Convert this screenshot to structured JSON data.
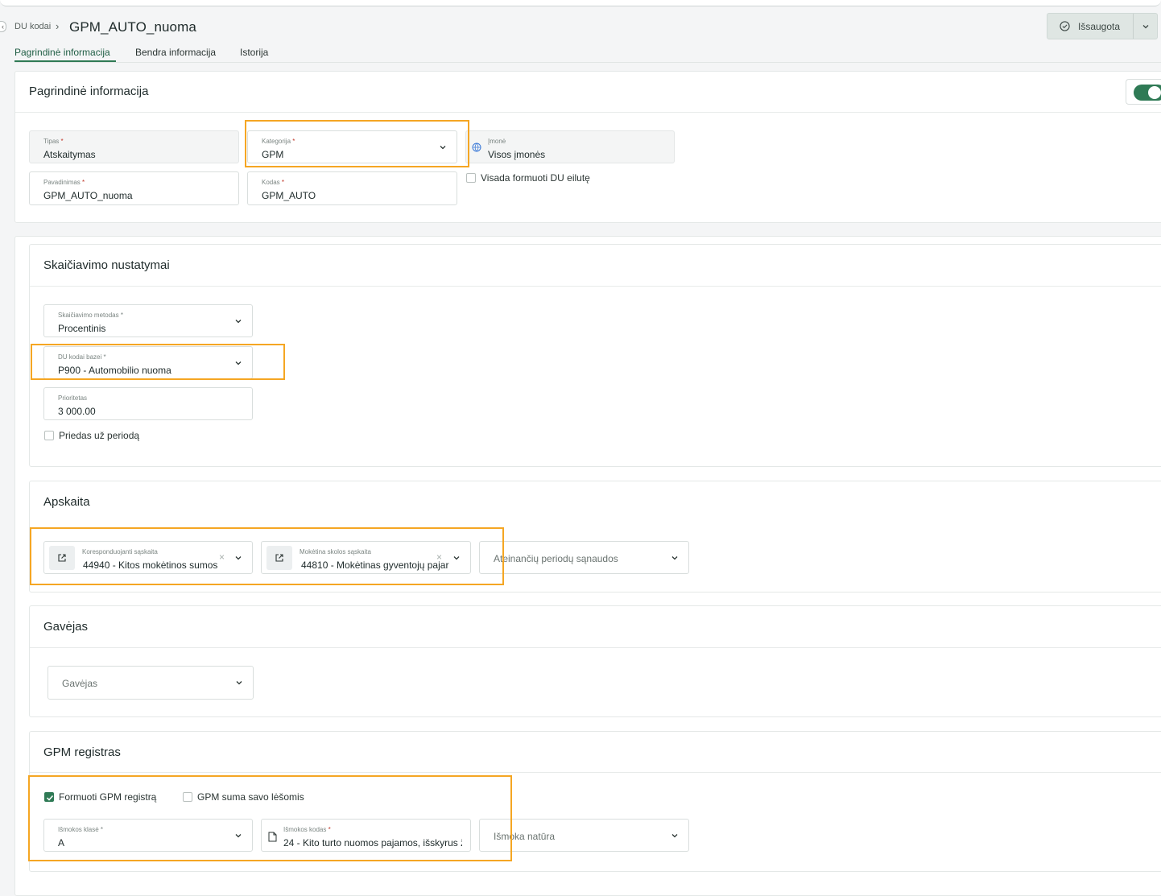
{
  "header": {
    "breadcrumb": "DU kodai",
    "title": "GPM_AUTO_nuoma",
    "save_label": "Išsaugota"
  },
  "tabs": [
    "Pagrindinė informacija",
    "Bendra informacija",
    "Istorija"
  ],
  "basic": {
    "title": "Pagrindinė informacija",
    "tipas": {
      "label": "Tipas",
      "value": "Atskaitymas"
    },
    "kategorija": {
      "label": "Kategorija",
      "value": "GPM"
    },
    "imone": {
      "label": "Įmonė",
      "value": "Visos įmonės"
    },
    "pavadinimas": {
      "label": "Pavadinimas",
      "value": "GPM_AUTO_nuoma"
    },
    "kodas": {
      "label": "Kodas",
      "value": "GPM_AUTO"
    },
    "visada_label": "Visada formuoti DU eilutę"
  },
  "calc": {
    "title": "Skaičiavimo nustatymai",
    "metodas": {
      "label": "Skaičiavimo metodas",
      "value": "Procentinis"
    },
    "bazei": {
      "label": "DU kodai bazei",
      "value": "P900 - Automobilio nuoma"
    },
    "prioritetas": {
      "label": "Prioritetas",
      "value": "3 000.00"
    },
    "priedas_label": "Priedas už periodą"
  },
  "apskaita": {
    "title": "Apskaita",
    "koresp": {
      "label": "Koresponduojanti sąskaita",
      "value": "44940 - Kitos mokėtinos sumos"
    },
    "moketina": {
      "label": "Mokėtina skolos sąskaita",
      "value": "44810 - Mokėtinas gyventojų pajar"
    },
    "ateinanciu_placeholder": "Ateinančių periodų sąnaudos"
  },
  "gavejas": {
    "title": "Gavėjas",
    "placeholder": "Gavėjas"
  },
  "gpm": {
    "title": "GPM registras",
    "formuoti_label": "Formuoti GPM registrą",
    "formuoti_checked": true,
    "suma_label": "GPM suma savo lėšomis",
    "suma_checked": false,
    "klase": {
      "label": "Išmokos klasė",
      "value": "A"
    },
    "kodas": {
      "label": "Išmokos kodas",
      "value": "24 - Kito turto nuomos pajamos, išskyrus ž"
    },
    "natura_placeholder": "Išmoka natūra"
  },
  "colors": {
    "accent": "#2f7a55",
    "highlight": "#f5a623"
  }
}
